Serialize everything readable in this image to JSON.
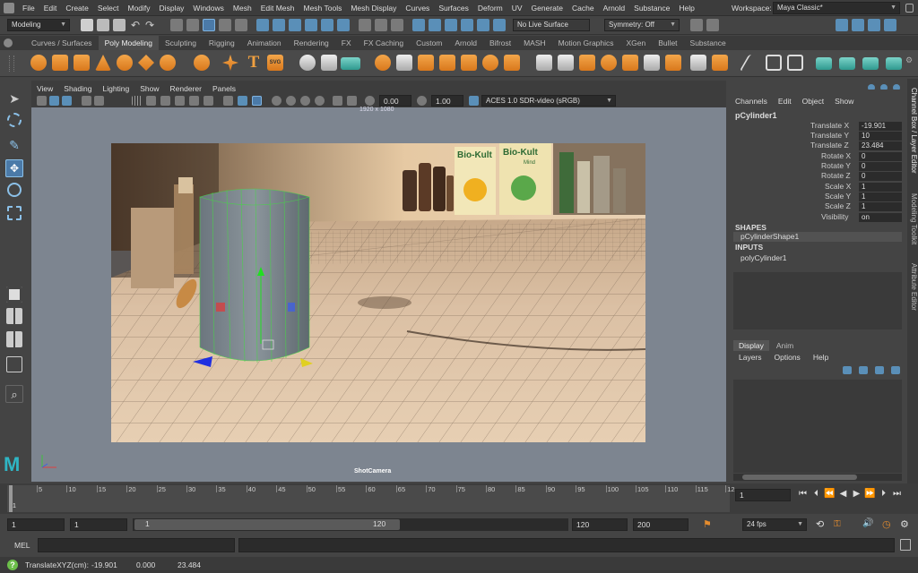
{
  "menubar": {
    "items": [
      "File",
      "Edit",
      "Create",
      "Select",
      "Modify",
      "Display",
      "Windows",
      "Mesh",
      "Edit Mesh",
      "Mesh Tools",
      "Mesh Display",
      "Curves",
      "Surfaces",
      "Deform",
      "UV",
      "Generate",
      "Cache",
      "Arnold",
      "Substance",
      "Help"
    ],
    "workspace_label": "Workspace:",
    "workspace_value": "Maya Classic*"
  },
  "statusline": {
    "mode": "Modeling",
    "live_surface": "No Live Surface",
    "symmetry": "Symmetry: Off"
  },
  "shelf": {
    "tabs": [
      "Curves / Surfaces",
      "Poly Modeling",
      "Sculpting",
      "Rigging",
      "Animation",
      "Rendering",
      "FX",
      "FX Caching",
      "Custom",
      "Arnold",
      "Bifrost",
      "MASH",
      "Motion Graphics",
      "XGen",
      "Bullet",
      "Substance"
    ],
    "active_tab": "Poly Modeling",
    "svg_label": "SVG",
    "text_tool": "T"
  },
  "viewport": {
    "menu": [
      "View",
      "Shading",
      "Lighting",
      "Show",
      "Renderer",
      "Panels"
    ],
    "field1": "0.00",
    "field2": "1.00",
    "colorspace": "ACES 1.0 SDR-video (sRGB)",
    "resolution": "1920 x 1080",
    "camera": "ShotCamera",
    "label_biokult1": "Bio-Kult",
    "label_biokult2": "Bio-Kult",
    "label_biokult2_sub": "Mind"
  },
  "channel_box": {
    "menu": [
      "Channels",
      "Edit",
      "Object",
      "Show"
    ],
    "object": "pCylinder1",
    "attributes": [
      {
        "name": "Translate X",
        "value": "-19.901"
      },
      {
        "name": "Translate Y",
        "value": "10"
      },
      {
        "name": "Translate Z",
        "value": "23.484"
      },
      {
        "name": "Rotate X",
        "value": "0"
      },
      {
        "name": "Rotate Y",
        "value": "0"
      },
      {
        "name": "Rotate Z",
        "value": "0"
      },
      {
        "name": "Scale X",
        "value": "1"
      },
      {
        "name": "Scale Y",
        "value": "1"
      },
      {
        "name": "Scale Z",
        "value": "1"
      },
      {
        "name": "Visibility",
        "value": "on"
      }
    ],
    "shapes_header": "SHAPES",
    "shape_name": "pCylinderShape1",
    "inputs_header": "INPUTS",
    "input_name": "polyCylinder1"
  },
  "layer_editor": {
    "tabs": [
      "Display",
      "Anim"
    ],
    "active_tab": "Display",
    "menu": [
      "Layers",
      "Options",
      "Help"
    ]
  },
  "right_strip": {
    "labels": [
      "Channel Box / Layer Editor",
      "Modeling Toolkit",
      "Attribute Editor"
    ]
  },
  "timeline": {
    "ticks": [
      "5",
      "10",
      "15",
      "20",
      "25",
      "30",
      "35",
      "40",
      "45",
      "50",
      "55",
      "60",
      "65",
      "70",
      "75",
      "80",
      "85",
      "90",
      "95",
      "100",
      "105",
      "110",
      "115",
      "12"
    ],
    "current_frame": "1",
    "playhead_label": "1"
  },
  "range": {
    "start": "1",
    "anim_start": "1",
    "slider_start": "1",
    "slider_end": "120",
    "end": "120",
    "anim_end": "200",
    "fps": "24 fps"
  },
  "mel": {
    "label": "MEL"
  },
  "help": {
    "label": "TranslateXYZ(cm):",
    "x": "-19.901",
    "y": "0.000",
    "z": "23.484"
  },
  "colors": {
    "accent": "#5a8fb8",
    "shelf_orange": "#e58c2e",
    "selected_green": "#46d646"
  }
}
